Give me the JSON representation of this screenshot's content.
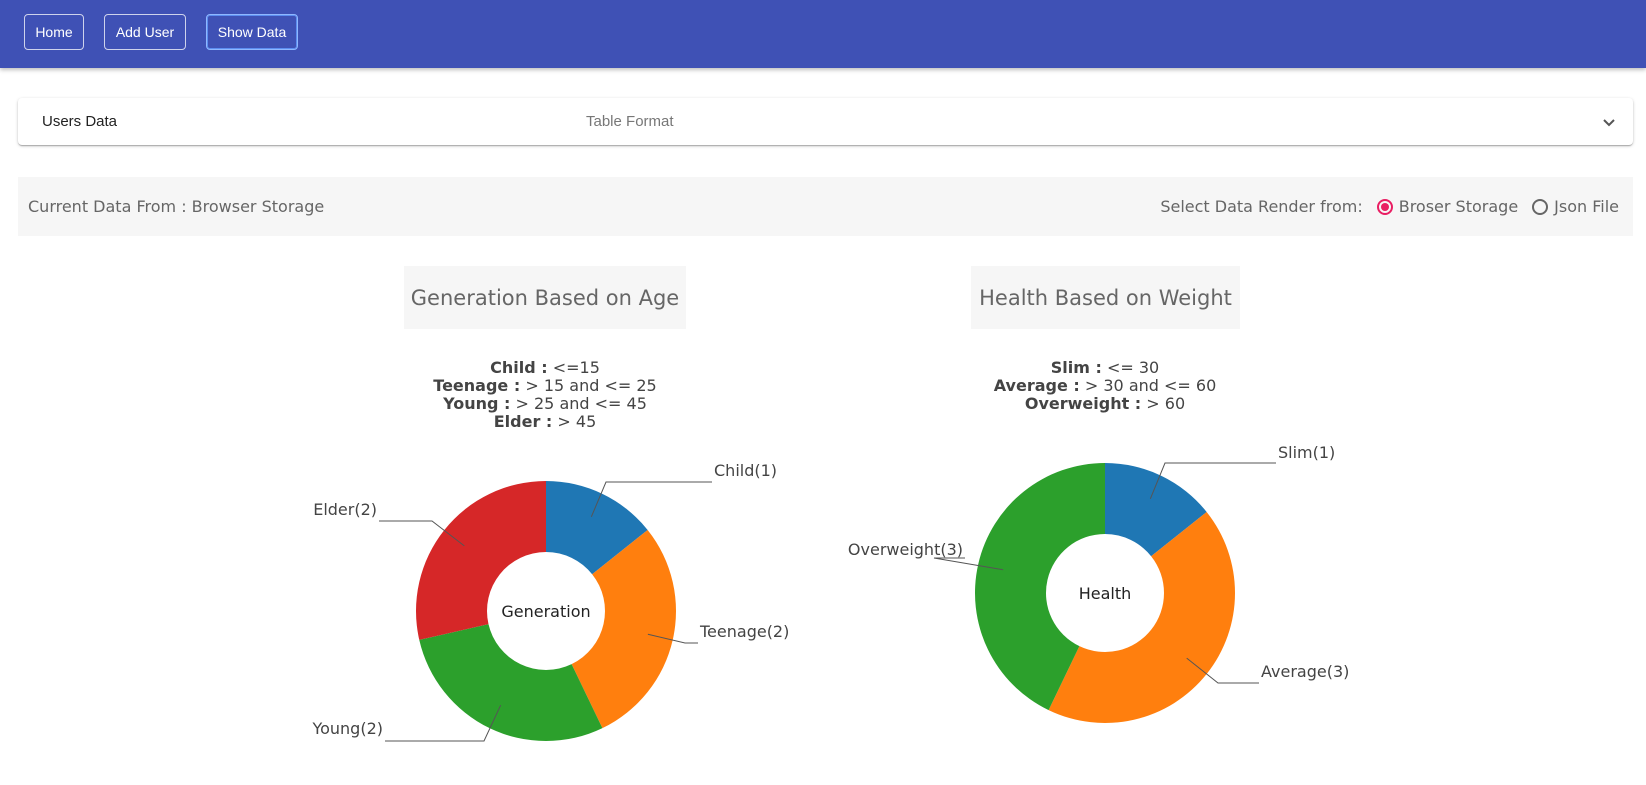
{
  "nav": {
    "home_label": "Home",
    "add_user_label": "Add User",
    "show_data_label": "Show Data"
  },
  "accordion": {
    "title": "Users Data",
    "subtitle": "Table Format"
  },
  "source": {
    "current_text": "Current Data From : Browser Storage",
    "select_label": "Select Data Render from:",
    "options": [
      {
        "label": "Broser Storage",
        "checked": true
      },
      {
        "label": "Json File",
        "checked": false
      }
    ]
  },
  "colors": {
    "blue": "#1f77b4",
    "orange": "#ff7f0e",
    "green": "#2ca02c",
    "red": "#d62728",
    "accent": "#e91e63",
    "header": "#3f51b5"
  },
  "charts_meta": [
    {
      "box_title": "Generation Based on Age",
      "criteria": [
        {
          "name": "Child :",
          "rule": " <=15"
        },
        {
          "name": "Teenage :",
          "rule": " > 15 and <= 25"
        },
        {
          "name": "Young :",
          "rule": " > 25 and <= 45"
        },
        {
          "name": "Elder :",
          "rule": " > 45"
        }
      ]
    },
    {
      "box_title": "Health Based on Weight",
      "criteria": [
        {
          "name": "Slim :",
          "rule": " <= 30"
        },
        {
          "name": "Average :",
          "rule": " > 30 and <= 60"
        },
        {
          "name": "Overweight :",
          "rule": " > 60"
        }
      ]
    }
  ],
  "chart_data": [
    {
      "type": "pie",
      "variant": "donut",
      "title": "Generation Based on Age",
      "center_label": "Generation",
      "categories": [
        "Child",
        "Teenage",
        "Young",
        "Elder"
      ],
      "values": [
        1,
        2,
        2,
        2
      ],
      "labels": [
        "Child(1)",
        "Teenage(2)",
        "Young(2)",
        "Elder(2)"
      ],
      "colors": [
        "#1f77b4",
        "#ff7f0e",
        "#2ca02c",
        "#d62728"
      ]
    },
    {
      "type": "pie",
      "variant": "donut",
      "title": "Health Based on Weight",
      "center_label": "Health",
      "categories": [
        "Slim",
        "Average",
        "Overweight"
      ],
      "values": [
        1,
        3,
        3
      ],
      "labels": [
        "Slim(1)",
        "Average(3)",
        "Overweight(3)"
      ],
      "colors": [
        "#1f77b4",
        "#ff7f0e",
        "#2ca02c"
      ]
    }
  ]
}
